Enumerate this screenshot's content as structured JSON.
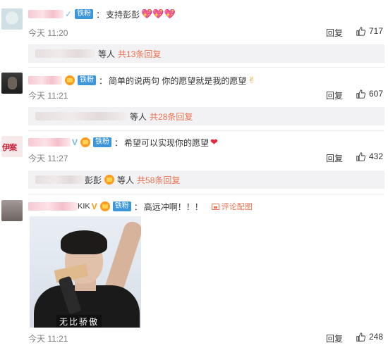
{
  "badge_label": "铁粉",
  "like_icon": "thumb-up-icon",
  "reply_label": "回复",
  "pic_button_label": "评论配图",
  "comments": [
    {
      "text": "支持彭彭",
      "emoji": "💖💖💖",
      "time": "今天 11:20",
      "likes": "717",
      "replies_suffix": "等人",
      "replies_count": "共13条回复"
    },
    {
      "text": "简单的说两句 你的愿望就是我的愿望",
      "emoji": "✌",
      "time": "今天 11:21",
      "likes": "607",
      "replies_suffix": "等人",
      "replies_count": "共28条回复"
    },
    {
      "avatar_text": "伊案",
      "text": "希望可以实现你的愿望",
      "emoji": "❤",
      "time": "今天 11:27",
      "likes": "432",
      "replies_name_tail": "彭彭",
      "replies_suffix": "等人",
      "replies_count": "共58条回复"
    },
    {
      "name_tail": "KIK",
      "text": "高远冲啊！！！",
      "time": "今天 11:21",
      "likes": "248",
      "image_caption": "无比骄傲"
    }
  ]
}
